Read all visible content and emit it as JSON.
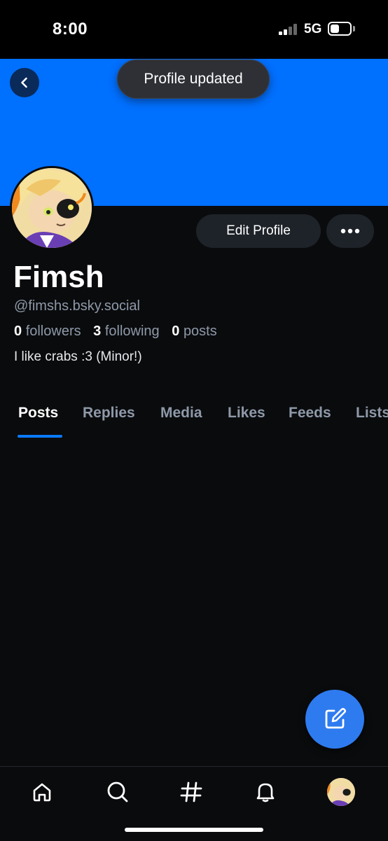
{
  "status_bar": {
    "time": "8:00",
    "network": "5G"
  },
  "toast": {
    "text": "Profile updated"
  },
  "profile": {
    "display_name": "Fimsh",
    "handle": "@fimshs.bsky.social",
    "followers_count": "0",
    "followers_label": "followers",
    "following_count": "3",
    "following_label": "following",
    "posts_count": "0",
    "posts_label": "posts",
    "bio": "I like crabs :3 (Minor!)"
  },
  "actions": {
    "edit_profile_label": "Edit Profile"
  },
  "tabs": [
    {
      "label": "Posts",
      "active": true
    },
    {
      "label": "Replies",
      "active": false
    },
    {
      "label": "Media",
      "active": false
    },
    {
      "label": "Likes",
      "active": false
    },
    {
      "label": "Feeds",
      "active": false
    },
    {
      "label": "Lists",
      "active": false
    }
  ],
  "bottom_nav": {
    "items": [
      {
        "icon": "home-icon"
      },
      {
        "icon": "search-icon"
      },
      {
        "icon": "hashtag-icon"
      },
      {
        "icon": "bell-icon"
      },
      {
        "icon": "profile-avatar"
      }
    ]
  },
  "colors": {
    "banner": "#0070ff",
    "accent": "#0a7aff",
    "background": "#0a0b0d",
    "fab": "#2e7bf0"
  }
}
